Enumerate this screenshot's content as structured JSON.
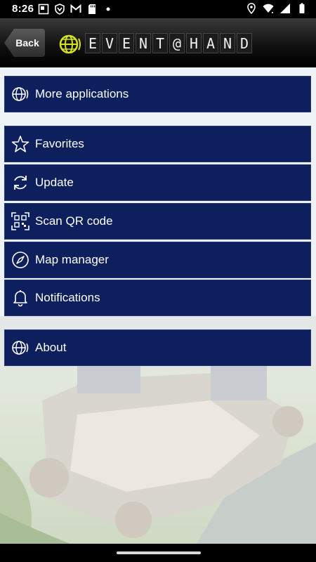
{
  "status_bar": {
    "time": "8:26",
    "left_icons": [
      "gallery-icon",
      "shield-icon",
      "gmail-icon",
      "sd-card-icon",
      "dot-icon"
    ],
    "right_icons": [
      "location-icon",
      "wifi-icon",
      "signal-icon",
      "battery-icon"
    ]
  },
  "header": {
    "back_label": "Back",
    "logo_text": "EVENT@HAND",
    "logo_letters": [
      "E",
      "V",
      "E",
      "N",
      "T",
      "@",
      "H",
      "A",
      "N",
      "D"
    ],
    "accent_color": "#d6e21a"
  },
  "menu": {
    "more_applications": "More applications",
    "favorites": "Favorites",
    "update": "Update",
    "scan_qr": "Scan QR code",
    "map_manager": "Map manager",
    "notifications": "Notifications",
    "about": "About"
  },
  "colors": {
    "menu_background": "#0d1f5c",
    "page_background": "#eef3f8"
  }
}
